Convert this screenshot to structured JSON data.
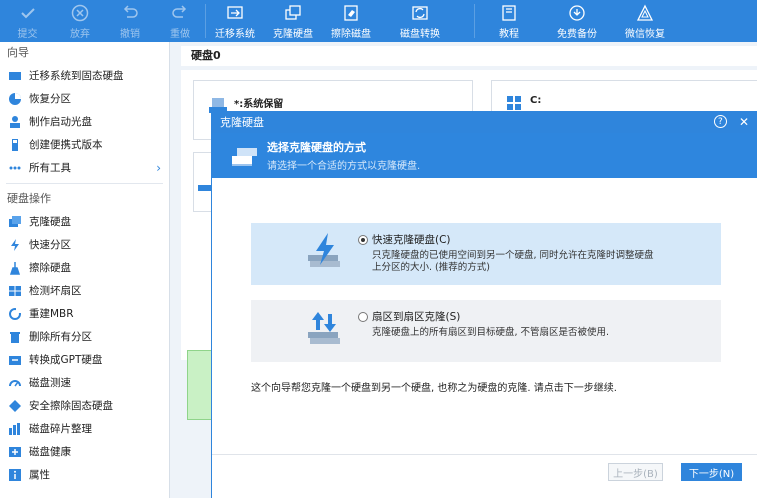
{
  "toolbar": {
    "apply": "提交",
    "discard": "放弃",
    "undo": "撤销",
    "redo": "重做",
    "migrate": "迁移系统",
    "clone": "克隆硬盘",
    "wipe": "擦除磁盘",
    "convert": "磁盘转换",
    "tutorial": "教程",
    "backup": "免费备份",
    "wechat": "微信恢复"
  },
  "sidebar": {
    "wizard_title": "向导",
    "wizard_items": [
      "迁移系统到固态硬盘",
      "恢复分区",
      "制作启动光盘",
      "创建便携式版本",
      "所有工具"
    ],
    "ops_title": "硬盘操作",
    "ops_items": [
      "克隆硬盘",
      "快速分区",
      "擦除硬盘",
      "检测坏扇区",
      "重建MBR",
      "删除所有分区",
      "转换成GPT硬盘",
      "磁盘测速",
      "安全擦除固态硬盘",
      "磁盘碎片整理",
      "磁盘健康",
      "属性"
    ]
  },
  "main": {
    "disk_label": "硬盘0",
    "part1_label": "*:系统保留",
    "part2_label": "C:"
  },
  "dialog": {
    "title": "克隆硬盘",
    "help_icon": "?",
    "close_icon": "✕",
    "header_title": "选择克隆硬盘的方式",
    "header_sub": "请选择一个合适的方式以克隆硬盘.",
    "option1_label": "快速克隆硬盘(C)",
    "option1_desc": "只克隆硬盘的已使用空间到另一个硬盘, 同时允许在克隆时调整硬盘上分区的大小. (推荐的方式)",
    "option2_label": "扇区到扇区克隆(S)",
    "option2_desc": "克隆硬盘上的所有扇区到目标硬盘, 不管扇区是否被使用.",
    "note": "这个向导帮您克隆一个硬盘到另一个硬盘, 也称之为硬盘的克隆. 请点击下一步继续.",
    "prev_btn": "上一步(B)",
    "next_btn": "下一步(N)"
  }
}
